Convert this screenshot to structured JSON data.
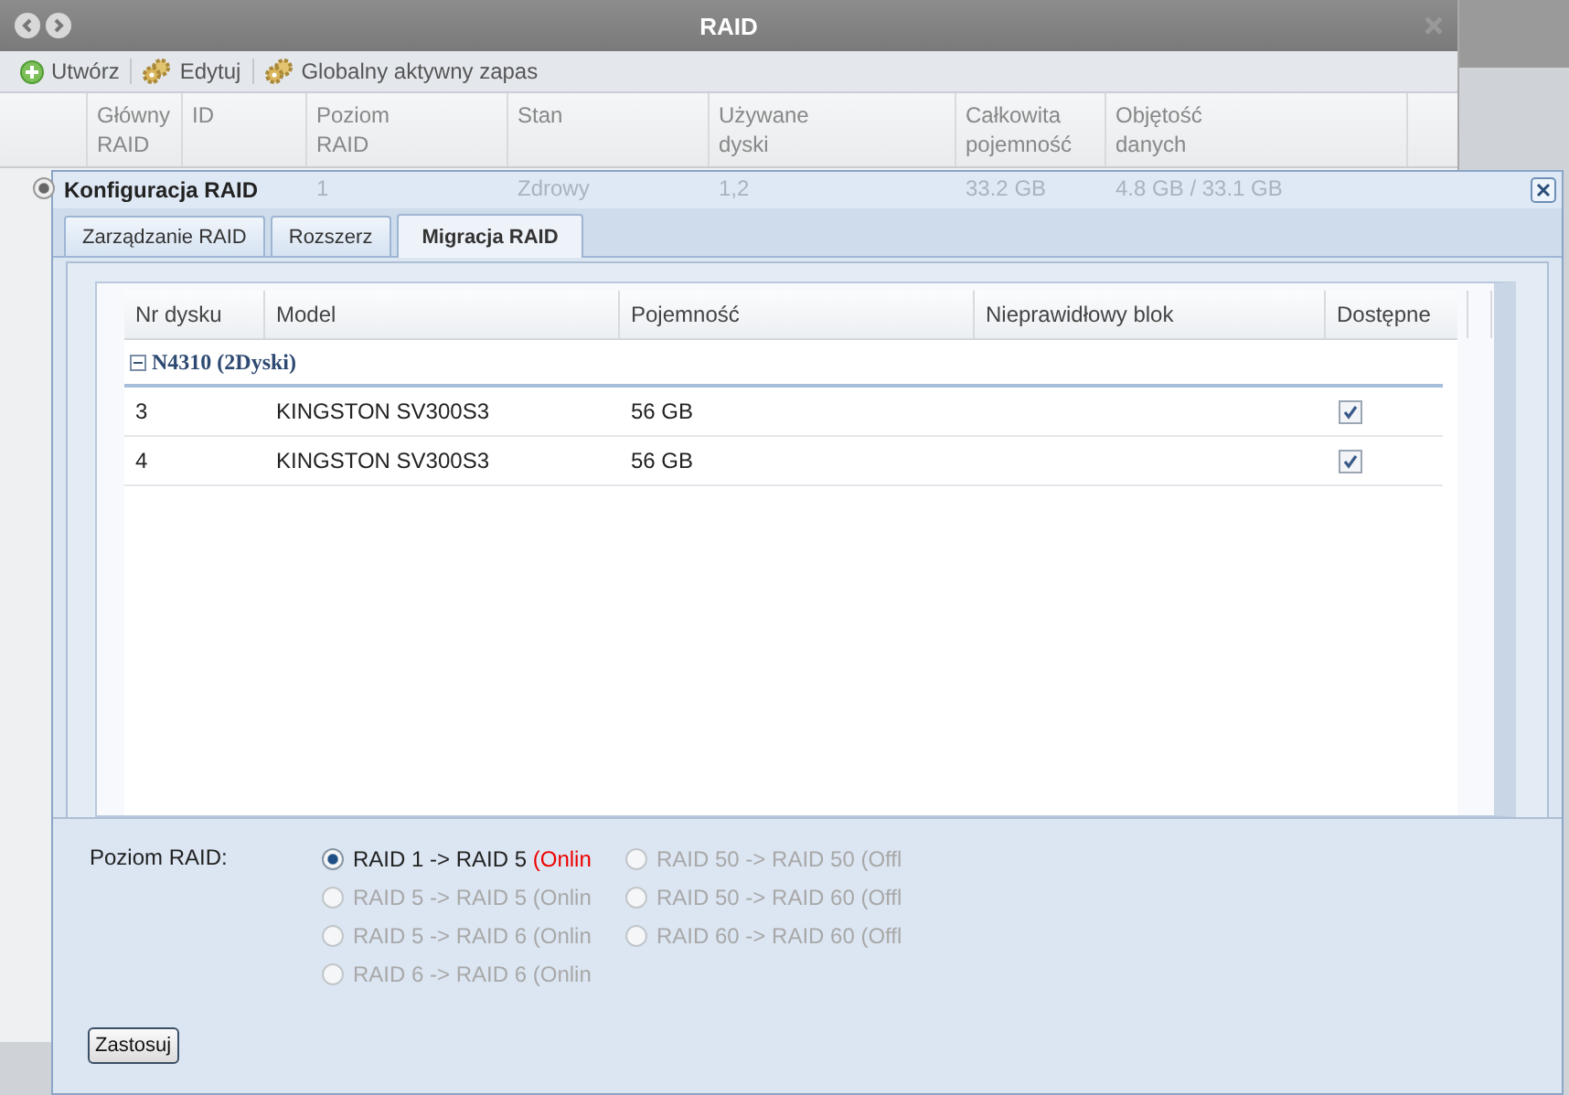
{
  "window": {
    "title": "RAID"
  },
  "toolbar": [
    {
      "label": "Utwórz",
      "kind": "add"
    },
    {
      "label": "Edytuj",
      "kind": "gear"
    },
    {
      "label": "Globalny aktywny zapas",
      "kind": "gear"
    }
  ],
  "raid_table": {
    "columns": [
      "Główny\nRAID",
      "ID",
      "Poziom\nRAID",
      "Stan",
      "Używane\ndyski",
      "Całkowita\npojemność",
      "Objętość\ndanych"
    ],
    "rows": [
      {
        "selected": true,
        "level": "1",
        "state": "Zdrowy",
        "used_disks": "1,2",
        "total_capacity": "33.2 GB",
        "data_volume": "4.8 GB / 33.1 GB"
      }
    ]
  },
  "dialog": {
    "title": "Konfiguracja RAID",
    "tabs": [
      {
        "label": "Zarządzanie RAID",
        "selected": false
      },
      {
        "label": "Rozszerz",
        "selected": false
      },
      {
        "label": "Migracja RAID",
        "selected": true
      }
    ],
    "disk_table": {
      "columns": [
        "Nr dysku",
        "Model",
        "Pojemność",
        "Nieprawidłowy blok",
        "Dostępne"
      ],
      "groups": [
        {
          "label": "N4310 (2Dyski)",
          "expanded": true,
          "rows": [
            {
              "nr": "3",
              "model": "KINGSTON SV300S3",
              "capacity": "56 GB",
              "available": true
            },
            {
              "nr": "4",
              "model": "KINGSTON SV300S3",
              "capacity": "56 GB",
              "available": true
            }
          ]
        }
      ]
    },
    "raid_level": {
      "label": "Poziom RAID:",
      "option_columns": [
        [
          {
            "label": "RAID 1 -> RAID 5",
            "note": "(Onlin",
            "selected": true,
            "disabled": false
          },
          {
            "label": "RAID 5 -> RAID 5",
            "note": "(Onlin",
            "selected": false,
            "disabled": true
          },
          {
            "label": "RAID 5 -> RAID 6",
            "note": "(Onlin",
            "selected": false,
            "disabled": true
          },
          {
            "label": "RAID 6 -> RAID 6",
            "note": "(Onlin",
            "selected": false,
            "disabled": true
          }
        ],
        [
          {
            "label": "RAID 50 -> RAID 50",
            "note": "(Offl",
            "selected": false,
            "disabled": true
          },
          {
            "label": "RAID 50 -> RAID 60",
            "note": "(Offl",
            "selected": false,
            "disabled": true
          },
          {
            "label": "RAID 60 -> RAID 60",
            "note": "(Offl",
            "selected": false,
            "disabled": true
          }
        ]
      ]
    },
    "apply_button": "Zastosuj"
  }
}
